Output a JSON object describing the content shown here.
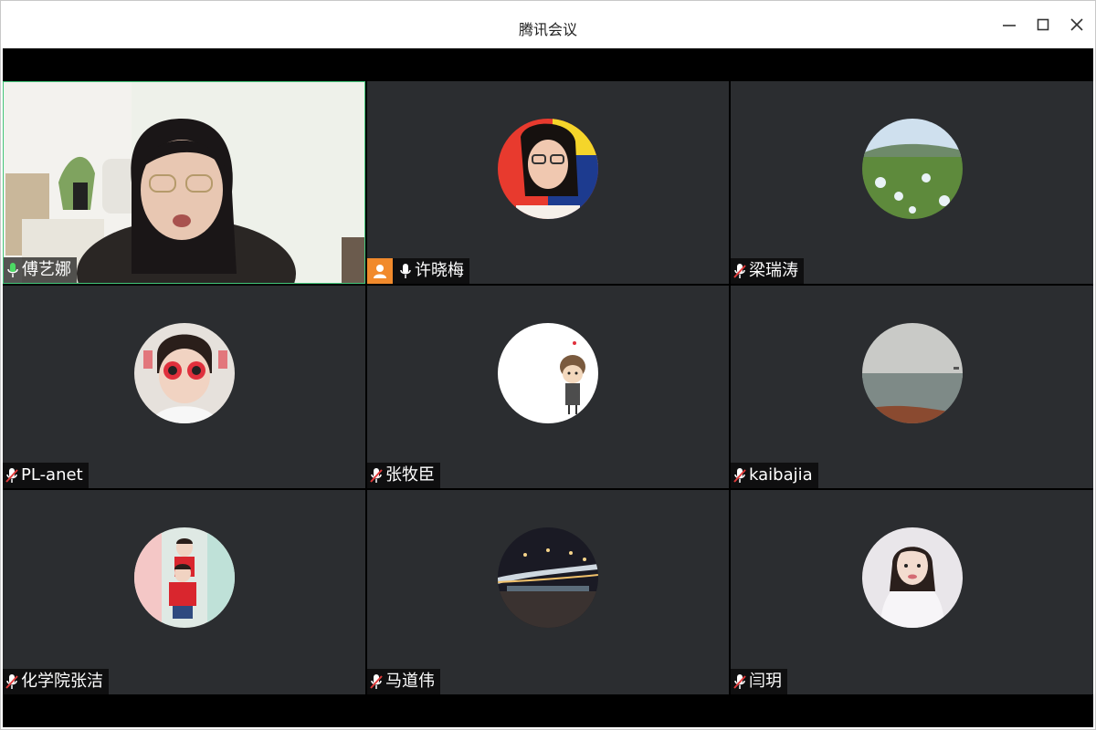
{
  "window": {
    "title": "腾讯会议"
  },
  "participants": [
    {
      "name": "傅艺娜",
      "mic": "active",
      "video": true,
      "picture": "video-feed"
    },
    {
      "name": "许晓梅",
      "mic": "on",
      "host": true,
      "picture": "woman-with-glasses"
    },
    {
      "name": "梁瑞涛",
      "mic": "muted",
      "picture": "green-field-landscape"
    },
    {
      "name": "PL-anet",
      "mic": "muted",
      "picture": "child-with-red-sunglasses"
    },
    {
      "name": "张牧臣",
      "mic": "muted",
      "picture": "cartoon-boy"
    },
    {
      "name": "kaibajia",
      "mic": "muted",
      "picture": "misty-sea"
    },
    {
      "name": "化学院张洁",
      "mic": "muted",
      "picture": "two-children"
    },
    {
      "name": "马道伟",
      "mic": "muted",
      "picture": "city-bridge-night"
    },
    {
      "name": "闫玥",
      "mic": "muted",
      "picture": "bride-portrait"
    }
  ],
  "colors": {
    "tile_bg": "#2b2d30",
    "host_badge": "#f18a2c",
    "active_border": "#43c67a",
    "mic_active": "#4cd964",
    "muted_slash": "#e23b3b"
  }
}
